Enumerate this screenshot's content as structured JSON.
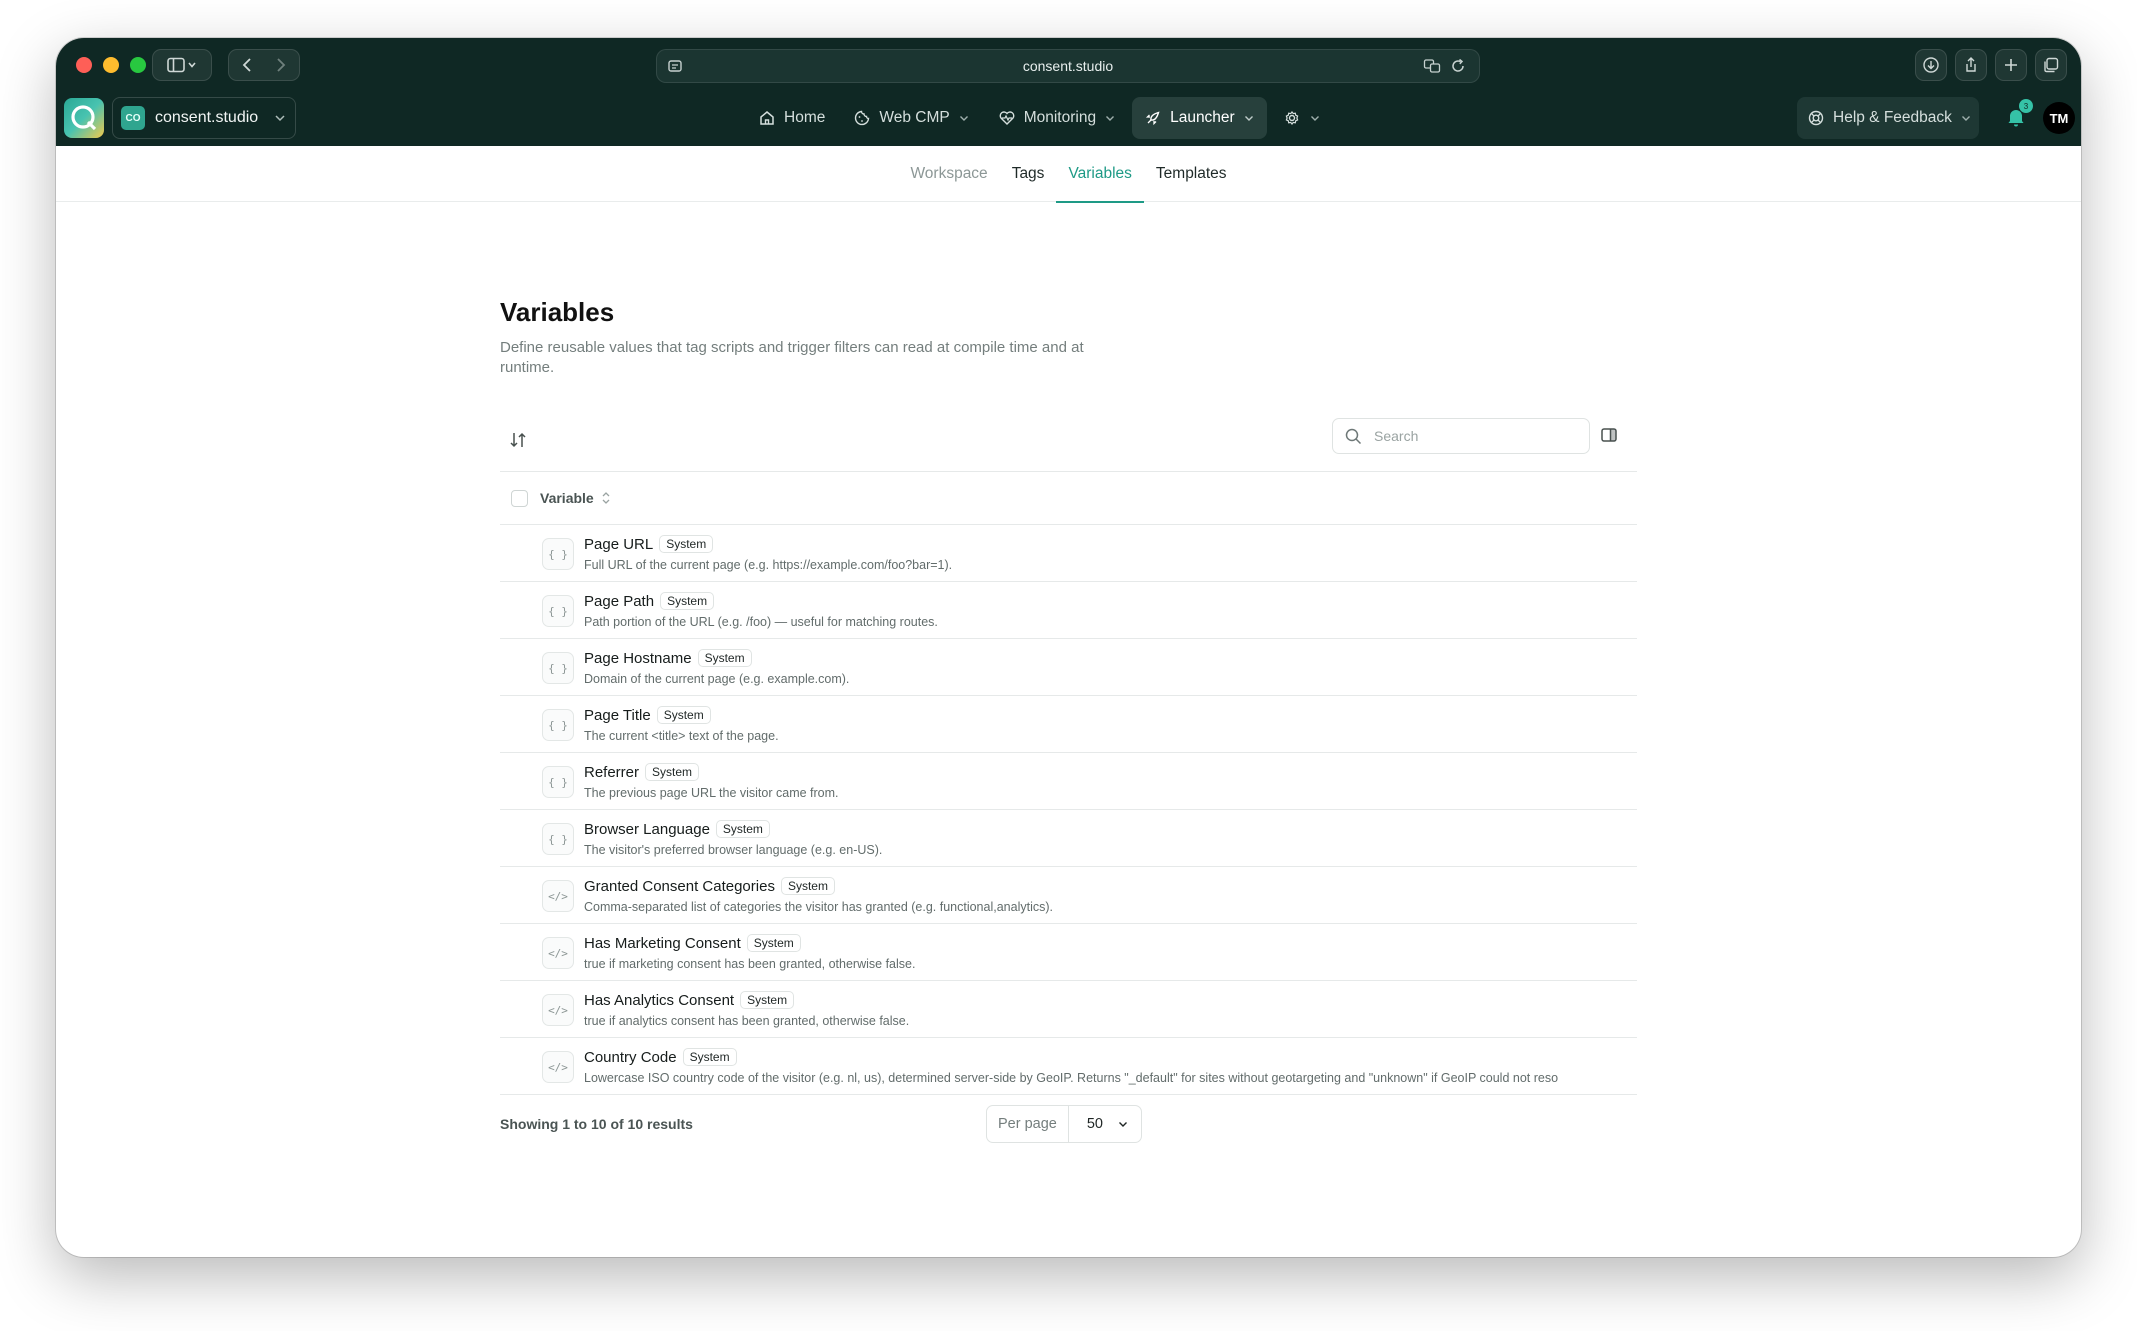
{
  "browser": {
    "url": "consent.studio"
  },
  "app": {
    "workspace_badge": "CO",
    "workspace_name": "consent.studio",
    "nav": [
      {
        "label": "Home"
      },
      {
        "label": "Web CMP"
      },
      {
        "label": "Monitoring"
      },
      {
        "label": "Launcher"
      }
    ],
    "help_label": "Help & Feedback",
    "notification_count": "3",
    "avatar_initials": "TM"
  },
  "subtabs": [
    {
      "label": "Workspace"
    },
    {
      "label": "Tags"
    },
    {
      "label": "Variables"
    },
    {
      "label": "Templates"
    }
  ],
  "page": {
    "title": "Variables",
    "description": "Define reusable values that tag scripts and trigger filters can read at compile time and at runtime."
  },
  "table": {
    "search_placeholder": "Search",
    "column_header": "Variable",
    "badge_label": "System",
    "rows": [
      {
        "icon": "{ }",
        "name": "Page URL",
        "description": "Full URL of the current page (e.g. https://example.com/foo?bar=1)."
      },
      {
        "icon": "{ }",
        "name": "Page Path",
        "description": "Path portion of the URL (e.g. /foo) — useful for matching routes."
      },
      {
        "icon": "{ }",
        "name": "Page Hostname",
        "description": "Domain of the current page (e.g. example.com)."
      },
      {
        "icon": "{ }",
        "name": "Page Title",
        "description": "The current <title> text of the page."
      },
      {
        "icon": "{ }",
        "name": "Referrer",
        "description": "The previous page URL the visitor came from."
      },
      {
        "icon": "{ }",
        "name": "Browser Language",
        "description": "The visitor's preferred browser language (e.g. en-US)."
      },
      {
        "icon": "</>",
        "name": "Granted Consent Categories",
        "description": "Comma-separated list of categories the visitor has granted (e.g. functional,analytics)."
      },
      {
        "icon": "</>",
        "name": "Has Marketing Consent",
        "description": "true if marketing consent has been granted, otherwise false."
      },
      {
        "icon": "</>",
        "name": "Has Analytics Consent",
        "description": "true if analytics consent has been granted, otherwise false."
      },
      {
        "icon": "</>",
        "name": "Country Code",
        "description": "Lowercase ISO country code of the visitor (e.g. nl, us), determined server-side by GeoIP. Returns \"_default\" for sites without geotargeting and \"unknown\" if GeoIP could not reso"
      }
    ]
  },
  "footer": {
    "results_text": "Showing 1 to 10 of 10 results",
    "per_page_label": "Per page",
    "per_page_value": "50"
  },
  "colors": {
    "chrome_bg": "#0f2824",
    "accent": "#1e9a86"
  }
}
